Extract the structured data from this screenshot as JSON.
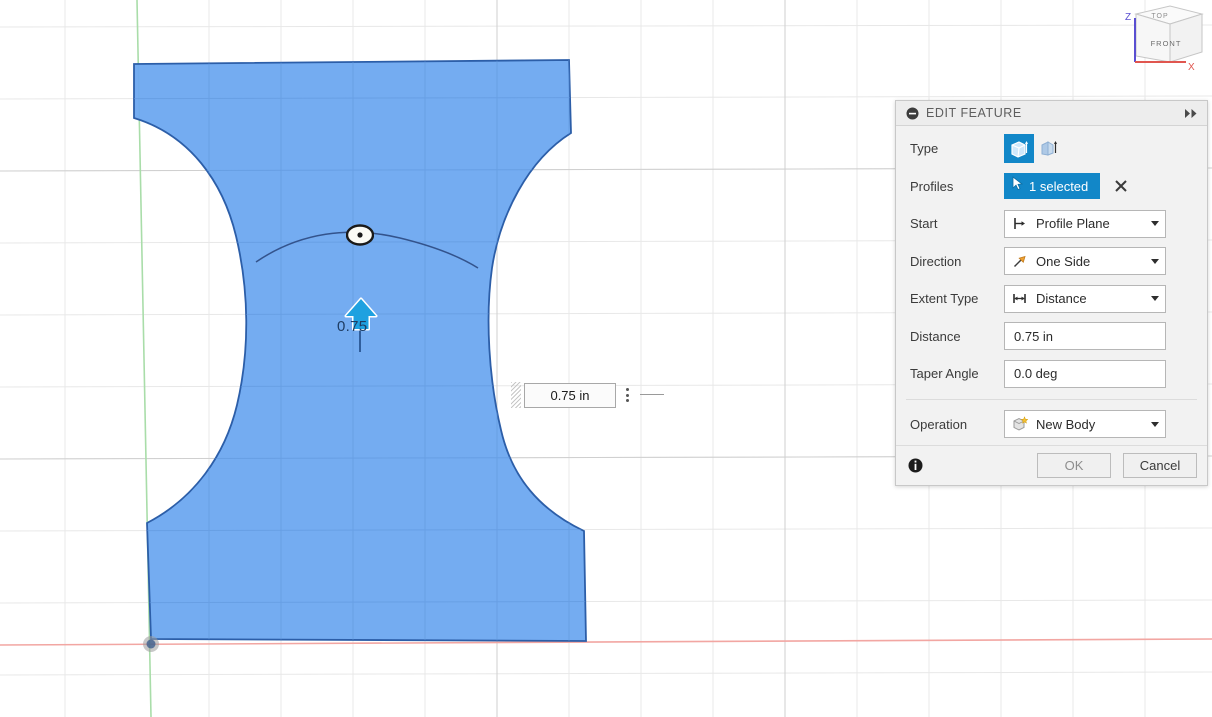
{
  "app": {
    "background_color": "#ffffff",
    "accent_color": "#1287c8",
    "body_fill_color": "#6da8f0",
    "body_edge_color": "#2c5ea8"
  },
  "viewcube": {
    "top_face_label": "TOP",
    "front_face_label": "FRONT",
    "axis_z_label": "Z",
    "axis_x_label": "X",
    "axis_z_color": "#5a4fd1",
    "axis_x_color": "#e0564f"
  },
  "canvas": {
    "grid_line_color": "#e0e0e0",
    "grid_major_color": "#cacaca",
    "x_axis_color": "#f3a8a4",
    "y_axis_color": "#a6dda6",
    "dimension_input": {
      "value": "0.75 in",
      "placeholder": "0.00 in",
      "grip_name": "drag-grip",
      "menu_name": "options-menu"
    },
    "manipulator": {
      "arrow_label": "0.75",
      "arrow_color": "#1ea1e0",
      "arrow_name": "extrude-direction-arrow",
      "arc_handle_name": "arc-drag-handle"
    },
    "origin_label": "origin-point"
  },
  "panel": {
    "title": "EDIT FEATURE",
    "collapse_icon": "minus-circle-icon",
    "expand_icon": "double-chevron-right-icon",
    "rows": {
      "type": {
        "label": "Type",
        "options": [
          {
            "name": "solid-extrude-icon",
            "selected": true
          },
          {
            "name": "thin-extrude-icon",
            "selected": false
          }
        ]
      },
      "profiles": {
        "label": "Profiles",
        "value": "1 selected",
        "select_icon": "cursor-arrow-icon",
        "clear_icon": "close-x-icon"
      },
      "start": {
        "label": "Start",
        "value": "Profile Plane",
        "icon": "profile-plane-icon"
      },
      "direction": {
        "label": "Direction",
        "value": "One Side",
        "icon": "one-side-arrow-icon"
      },
      "extent_type": {
        "label": "Extent Type",
        "value": "Distance",
        "icon": "distance-measure-icon"
      },
      "distance": {
        "label": "Distance",
        "value": "0.75 in",
        "placeholder": "0.00 in"
      },
      "taper_angle": {
        "label": "Taper Angle",
        "value": "0.0 deg",
        "placeholder": "0.0 deg"
      },
      "operation": {
        "label": "Operation",
        "value": "New Body",
        "icon": "new-body-icon"
      }
    },
    "footer": {
      "info_icon": "info-icon",
      "ok_label": "OK",
      "cancel_label": "Cancel"
    }
  }
}
